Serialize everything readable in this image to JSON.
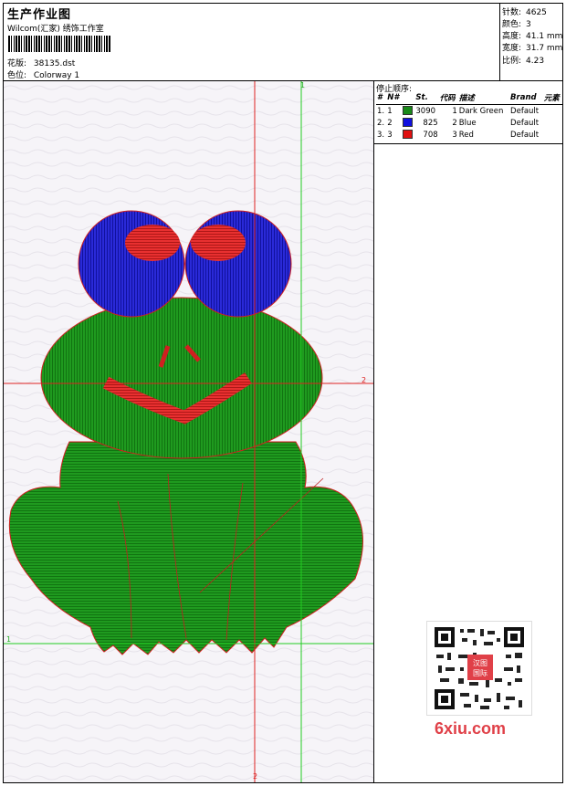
{
  "header": {
    "title": "生产作业图",
    "studio": "Wilcom(汇家) 绣饰工作室",
    "design_label": "花版:",
    "design_value": "38135.dst",
    "colorway_label": "色位:",
    "colorway_value": "Colorway 1"
  },
  "stats": [
    {
      "label": "针数:",
      "value": "4625"
    },
    {
      "label": "颜色:",
      "value": "3"
    },
    {
      "label": "高度:",
      "value": "41.1 mm"
    },
    {
      "label": "宽度:",
      "value": "31.7 mm"
    },
    {
      "label": "比例:",
      "value": "4.23"
    }
  ],
  "stop_sequence": {
    "title": "停止顺序:",
    "columns": [
      "#",
      "N#",
      "St.",
      "代码",
      "描述",
      "Brand",
      "元素"
    ],
    "rows": [
      {
        "num": "1.",
        "n": "1",
        "color": "#1a8a1a",
        "st": "3090",
        "code": "1",
        "desc": "Dark Green",
        "brand": "Default"
      },
      {
        "num": "2.",
        "n": "2",
        "color": "#1010e0",
        "st": "825",
        "code": "2",
        "desc": "Blue",
        "brand": "Default"
      },
      {
        "num": "3.",
        "n": "3",
        "color": "#e01010",
        "st": "708",
        "code": "3",
        "desc": "Red",
        "brand": "Default"
      }
    ]
  },
  "guides": {
    "top": "1",
    "right": "2",
    "left": "1",
    "bottom": "2"
  },
  "watermark": {
    "site": "6xiu.com",
    "badge": "汉图\n国际"
  }
}
